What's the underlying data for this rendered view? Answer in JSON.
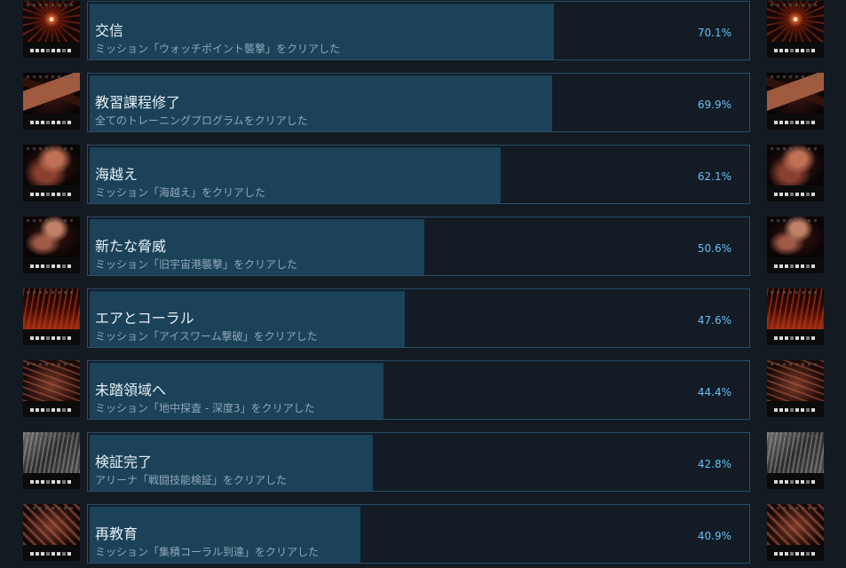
{
  "achievements": [
    {
      "title": "交信",
      "description": "ミッション「ウォッチポイント襲撃」をクリアした",
      "percent_label": "70.1%",
      "percent": 70.1,
      "icon": "achievement-icon-signal-burst",
      "art": "burst"
    },
    {
      "title": "教習課程修了",
      "description": "全てのトレーニングプログラムをクリアした",
      "percent_label": "69.9%",
      "percent": 69.9,
      "icon": "achievement-icon-training-plate",
      "art": "plate"
    },
    {
      "title": "海越え",
      "description": "ミッション「海越え」をクリアした",
      "percent_label": "62.1%",
      "percent": 62.1,
      "icon": "achievement-icon-machine",
      "art": "machine"
    },
    {
      "title": "新たな脅威",
      "description": "ミッション「旧宇宙港襲撃」をクリアした",
      "percent_label": "50.6%",
      "percent": 50.6,
      "icon": "achievement-icon-arm",
      "art": "arm"
    },
    {
      "title": "エアとコーラル",
      "description": "ミッション「アイスワーム撃破」をクリアした",
      "percent_label": "47.6%",
      "percent": 47.6,
      "icon": "achievement-icon-flames",
      "art": "flames"
    },
    {
      "title": "未踏領域へ",
      "description": "ミッション「地中探査 - 深度3」をクリアした",
      "percent_label": "44.4%",
      "percent": 44.4,
      "icon": "achievement-icon-terrain",
      "art": "terrain"
    },
    {
      "title": "検証完了",
      "description": "アリーナ「戦闘技能検証」をクリアした",
      "percent_label": "42.8%",
      "percent": 42.8,
      "icon": "achievement-icon-grey-panels",
      "art": "grey"
    },
    {
      "title": "再教育",
      "description": "ミッション「集積コーラル到達」をクリアした",
      "percent_label": "40.9%",
      "percent": 40.9,
      "icon": "achievement-icon-structure",
      "art": "structure"
    }
  ],
  "colors": {
    "accent_percent": "#66c0f4",
    "bar_fill": "#1b4259",
    "card_border": "#25506a",
    "background": "#141a22"
  }
}
